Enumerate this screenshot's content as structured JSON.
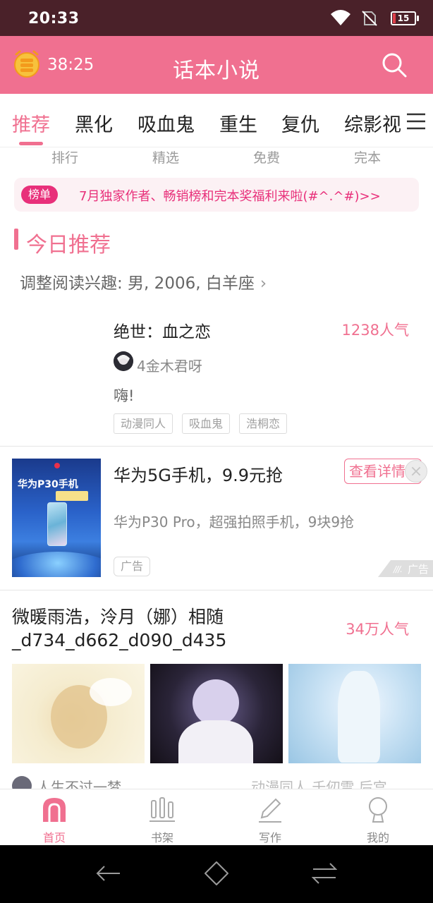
{
  "status_bar": {
    "time": "20:33",
    "battery": "15"
  },
  "app_bar": {
    "timer": "38:25",
    "title": "话本小说"
  },
  "category_tabs": [
    {
      "label": "推荐",
      "active": true
    },
    {
      "label": "黑化"
    },
    {
      "label": "吸血鬼"
    },
    {
      "label": "重生"
    },
    {
      "label": "复仇"
    },
    {
      "label": "综影视"
    }
  ],
  "sub_nav": [
    "排行",
    "精选",
    "免费",
    "完本"
  ],
  "banner": {
    "badge": "榜单",
    "text": "7月独家作者、畅销榜和完本奖福利来啦(#^.^#)>>"
  },
  "section": {
    "title": "今日推荐",
    "interest": "调整阅读兴趣: 男, 2006, 白羊座"
  },
  "book1": {
    "title": "绝世：血之恋",
    "popularity": "1238人气",
    "author": "4金木君呀",
    "description": "嗨!",
    "tags": [
      "动漫同人",
      "吸血鬼",
      "浩桐恋"
    ]
  },
  "ad": {
    "image_title": "华为P30手机",
    "title": "华为5G手机，9.9元抢",
    "description": "华为P30 Pro，超强拍照手机，9块9抢",
    "detail_button": "查看详情",
    "label": "广告",
    "corner_label": "广告"
  },
  "book2": {
    "title": "微暖雨浩，泠月（娜）相随_d734_d662_d090_d435",
    "popularity": "34万人气",
    "author": "人生不过一梦",
    "tags": "动漫同人  千仞雪  后宫"
  },
  "bottom_nav": [
    {
      "label": "首页",
      "icon": "home-icon",
      "active": true
    },
    {
      "label": "书架",
      "icon": "bookshelf-icon"
    },
    {
      "label": "写作",
      "icon": "pencil-icon"
    },
    {
      "label": "我的",
      "icon": "profile-icon"
    }
  ],
  "colors": {
    "accent": "#f07090",
    "status_bar": "#4a2129",
    "badge": "#e8307a"
  }
}
